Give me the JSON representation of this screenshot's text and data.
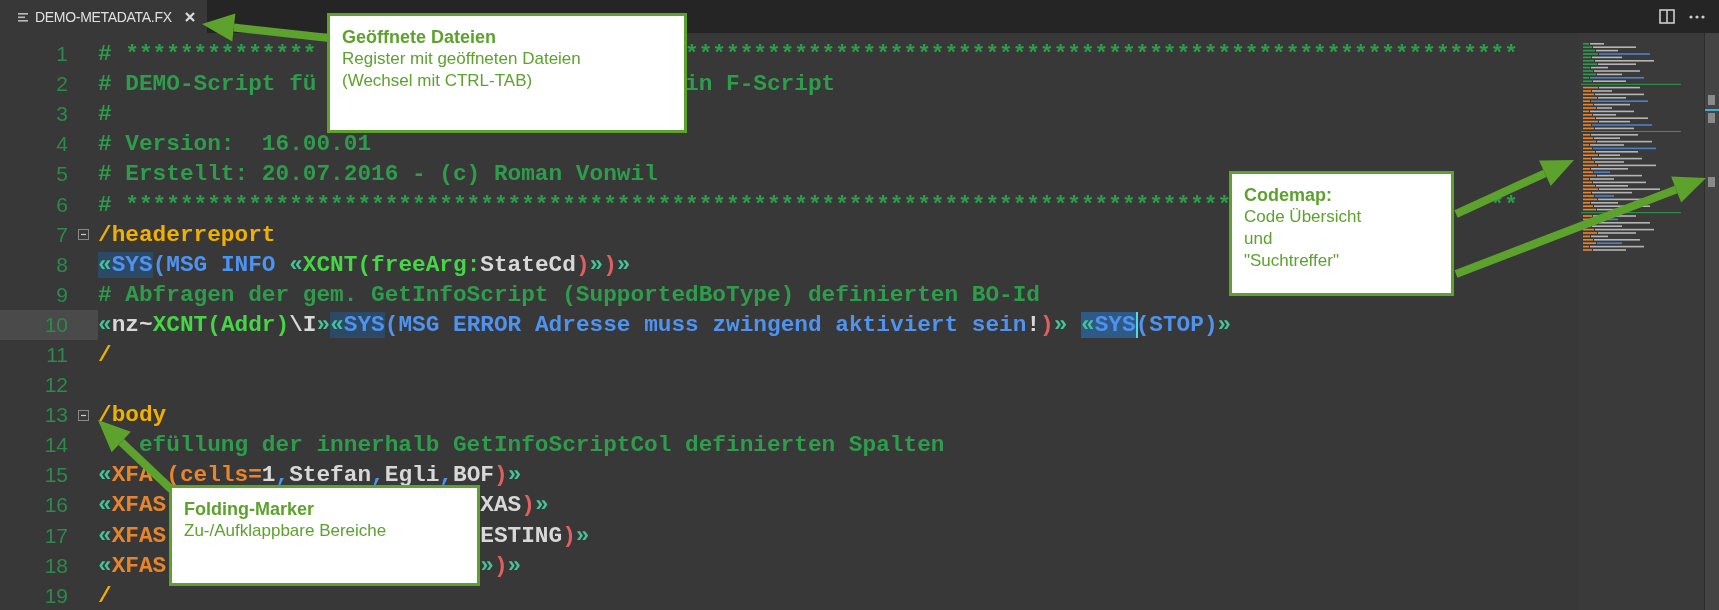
{
  "tabs": [
    {
      "title": "DEMO-METADATA.FX",
      "selected": true
    }
  ],
  "lines": [
    {
      "number": "1",
      "current": false,
      "tokens": [
        {
          "text": "# **************",
          "kind": "comment"
        },
        {
          "kind": "gap"
        },
        {
          "text": "*************************************************************",
          "kind": "comment"
        }
      ]
    },
    {
      "number": "2",
      "current": false,
      "tokens": [
        {
          "text": "# DEMO-Script fü",
          "kind": "comment"
        },
        {
          "kind": "gap"
        },
        {
          "text": "in F-Script",
          "kind": "comment"
        }
      ]
    },
    {
      "number": "3",
      "current": false,
      "tokens": [
        {
          "text": "#",
          "kind": "comment"
        }
      ]
    },
    {
      "number": "4",
      "current": false,
      "tokens": [
        {
          "text": "# Version:  16.00.01",
          "kind": "comment"
        }
      ]
    },
    {
      "number": "5",
      "current": false,
      "tokens": [
        {
          "text": "# Erstellt: 20.07.2016 - (c) Roman Vonwil",
          "kind": "comment"
        }
      ]
    },
    {
      "number": "6",
      "current": false,
      "tokens": [
        {
          "text": "# *********************************************************************************",
          "kind": "comment"
        },
        {
          "kind": "gap"
        },
        {
          "text": "**",
          "kind": "comment"
        }
      ]
    },
    {
      "number": "7",
      "current": false,
      "expanded": true,
      "tokens": [
        {
          "text": "/headerreport",
          "kind": "section"
        }
      ]
    },
    {
      "number": "8",
      "current": false,
      "tokens": [
        {
          "text": "«",
          "kind": "guillemet",
          "match": true
        },
        {
          "text": "SYS",
          "kind": "sys",
          "match": true
        },
        {
          "text": "(MSG INFO ",
          "kind": "sys"
        },
        {
          "text": "«",
          "kind": "guillemet"
        },
        {
          "text": "XCNT(freeArg:",
          "kind": "xcnt"
        },
        {
          "text": "StateCd",
          "kind": "plain"
        },
        {
          "text": ")",
          "kind": "paren"
        },
        {
          "text": "»",
          "kind": "guillemet"
        },
        {
          "text": ")",
          "kind": "paren"
        },
        {
          "text": "»",
          "kind": "guillemet"
        }
      ]
    },
    {
      "number": "9",
      "current": false,
      "tokens": [
        {
          "text": "# Abfragen der gem. GetInfoScript (SupportedBoType) definierten BO-Id",
          "kind": "comment"
        }
      ]
    },
    {
      "number": "10",
      "current": true,
      "tokens": [
        {
          "text": "«",
          "kind": "guillemet"
        },
        {
          "text": "nz~",
          "kind": "plain"
        },
        {
          "text": "XCNT(Addr)",
          "kind": "xcnt"
        },
        {
          "text": "\\I",
          "kind": "plain"
        },
        {
          "text": "»",
          "kind": "guillemet"
        },
        {
          "text": "«",
          "kind": "guillemet",
          "match": true
        },
        {
          "text": "SYS",
          "kind": "sys",
          "match": true
        },
        {
          "text": "(MSG ERROR Adresse muss zwingend aktiviert sein",
          "kind": "sys"
        },
        {
          "text": "!",
          "kind": "plain"
        },
        {
          "text": ")",
          "kind": "paren"
        },
        {
          "text": "» ",
          "kind": "guillemet"
        },
        {
          "text": "«",
          "kind": "guillemet",
          "selected": true
        },
        {
          "text": "SYS",
          "kind": "sys",
          "selected": true
        },
        {
          "text": "(STOP)",
          "kind": "sys"
        },
        {
          "text": "»",
          "kind": "guillemet"
        }
      ]
    },
    {
      "number": "11",
      "current": false,
      "tokens": [
        {
          "text": "/",
          "kind": "section"
        }
      ]
    },
    {
      "number": "12",
      "current": false
    },
    {
      "number": "13",
      "current": false,
      "expanded": true,
      "tokens": [
        {
          "text": "/body",
          "kind": "section"
        }
      ]
    },
    {
      "number": "14",
      "current": false,
      "tokens": [
        {
          "kind": "gap"
        },
        {
          "text": "efüllung der innerhalb GetInfoScriptCol definierten Spalten",
          "kind": "comment"
        }
      ]
    },
    {
      "number": "15",
      "current": false,
      "tokens": [
        {
          "text": "«",
          "kind": "guillemet"
        },
        {
          "text": "XFA",
          "kind": "xfas"
        },
        {
          "kind": "gap"
        },
        {
          "text": "(cells=",
          "kind": "xfas"
        },
        {
          "text": "1",
          "kind": "plain"
        },
        {
          "text": ",",
          "kind": "sys"
        },
        {
          "text": "Stefan",
          "kind": "plain"
        },
        {
          "text": ",",
          "kind": "sys"
        },
        {
          "text": "Egli",
          "kind": "plain"
        },
        {
          "text": ",",
          "kind": "sys"
        },
        {
          "text": "BOF",
          "kind": "plain"
        },
        {
          "text": ")",
          "kind": "paren"
        },
        {
          "text": "»",
          "kind": "guillemet"
        }
      ]
    },
    {
      "number": "16",
      "current": false,
      "tokens": [
        {
          "text": "«",
          "kind": "guillemet"
        },
        {
          "text": "XFAS",
          "kind": "xfas"
        },
        {
          "kind": "gap"
        },
        {
          "text": "XAS",
          "kind": "plain"
        },
        {
          "text": ")",
          "kind": "paren"
        },
        {
          "text": "»",
          "kind": "guillemet"
        }
      ]
    },
    {
      "number": "17",
      "current": false,
      "tokens": [
        {
          "text": "«",
          "kind": "guillemet"
        },
        {
          "text": "XFAS",
          "kind": "xfas"
        },
        {
          "kind": "gap"
        },
        {
          "text": "ESTING",
          "kind": "plain"
        },
        {
          "text": ")",
          "kind": "paren"
        },
        {
          "text": "»",
          "kind": "guillemet"
        }
      ]
    },
    {
      "number": "18",
      "current": false,
      "tokens": [
        {
          "text": "«",
          "kind": "guillemet"
        },
        {
          "text": "XFAS",
          "kind": "xfas"
        },
        {
          "kind": "gap"
        },
        {
          "text": "»",
          "kind": "guillemet"
        },
        {
          "text": ")",
          "kind": "paren"
        },
        {
          "text": "»",
          "kind": "guillemet"
        }
      ]
    },
    {
      "number": "19",
      "current": false,
      "tokens": [
        {
          "text": "/",
          "kind": "section"
        }
      ]
    }
  ],
  "callouts": [
    {
      "title": "Geöffnete Dateien",
      "lines": [
        "Register mit geöffneten Dateien",
        "(Wechsel mit CTRL-TAB)"
      ]
    },
    {
      "title": "Codemap:",
      "lines": [
        "Code Übersicht",
        "und",
        "\"Suchtreffer\""
      ]
    },
    {
      "title": "Folding-Marker",
      "lines": [
        "Zu-/Aufklappbare Bereiche"
      ]
    }
  ]
}
